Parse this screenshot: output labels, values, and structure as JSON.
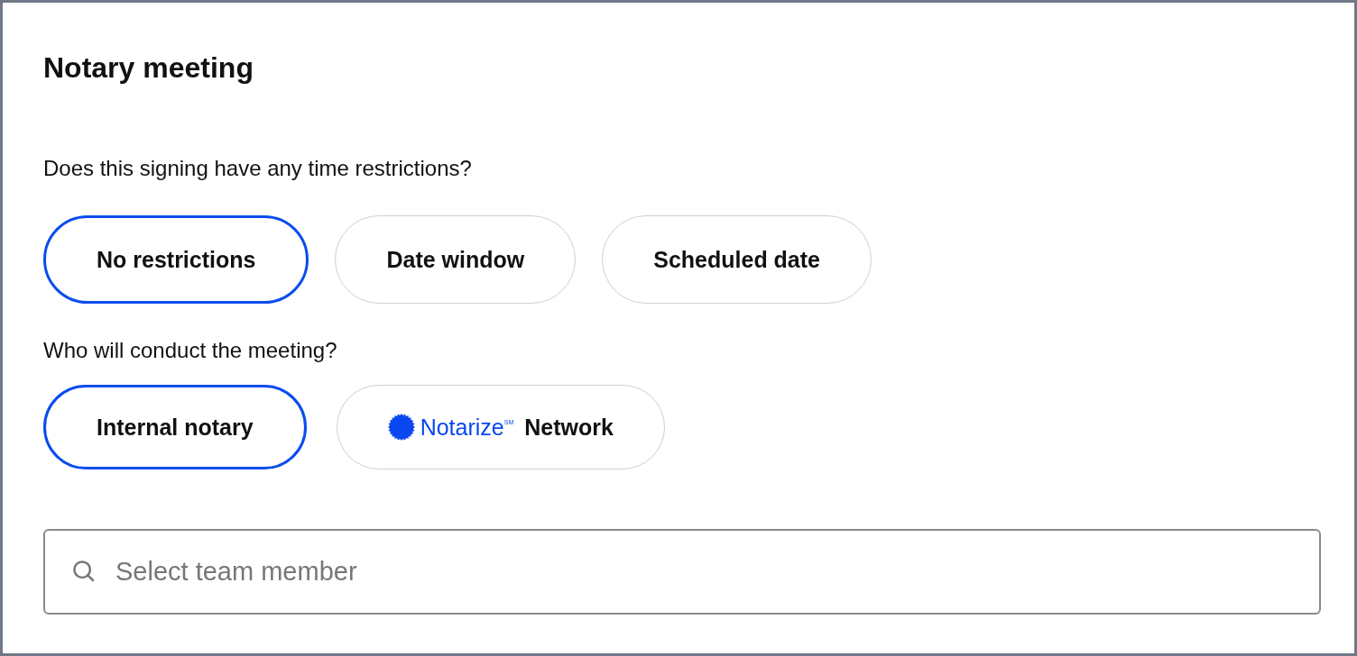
{
  "title": "Notary meeting",
  "questions": [
    {
      "label": "Does this signing have any time restrictions?",
      "options": [
        {
          "kind": "text",
          "label": "No restrictions",
          "selected": true
        },
        {
          "kind": "text",
          "label": "Date window",
          "selected": false
        },
        {
          "kind": "text",
          "label": "Scheduled date",
          "selected": false
        }
      ]
    },
    {
      "label": "Who will conduct the meeting?",
      "options": [
        {
          "kind": "text",
          "label": "Internal notary",
          "selected": true
        },
        {
          "kind": "brand",
          "brand": "Notarize",
          "brand_mark": "SM",
          "label": "Network",
          "selected": false
        }
      ]
    }
  ],
  "search": {
    "placeholder": "Select team member"
  }
}
